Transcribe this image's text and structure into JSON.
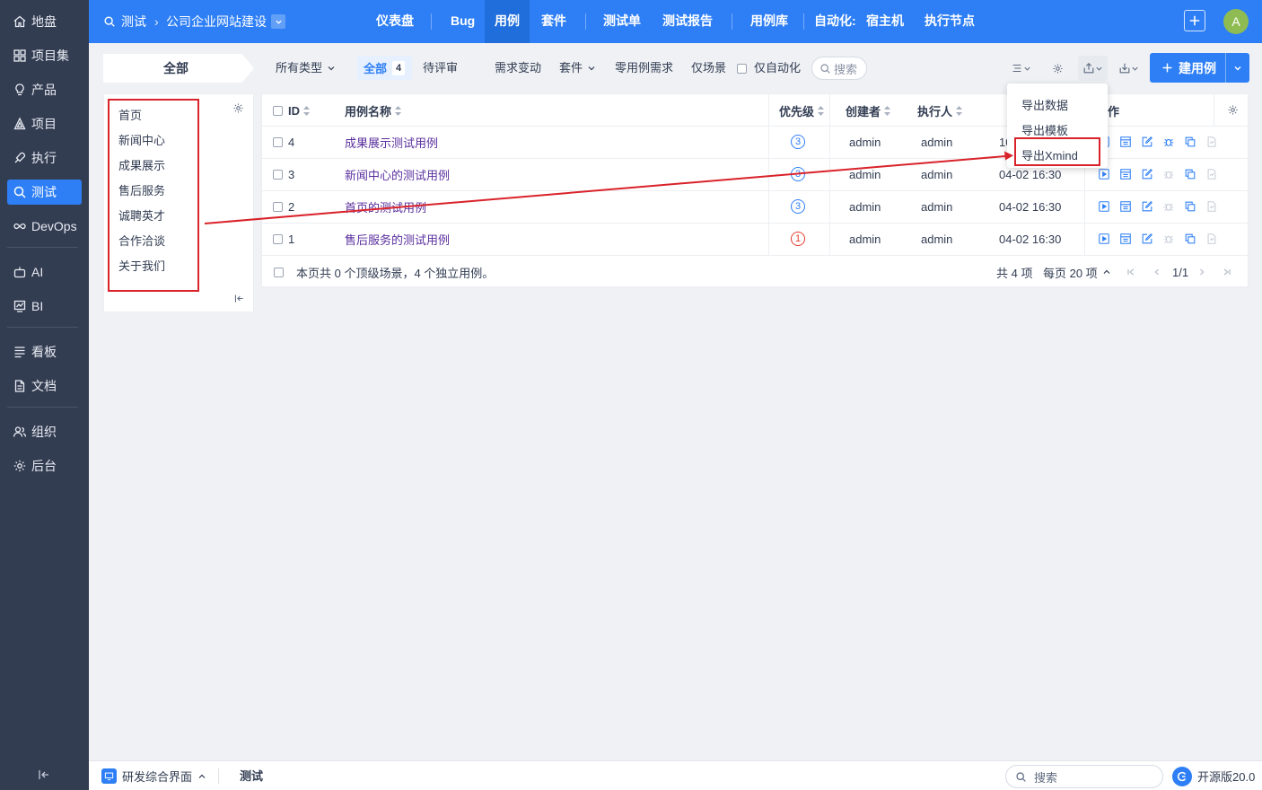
{
  "sidebar": {
    "items": [
      {
        "label": "地盘",
        "icon": "home-icon"
      },
      {
        "label": "项目集",
        "icon": "grid-icon"
      },
      {
        "label": "产品",
        "icon": "bulb-icon"
      },
      {
        "label": "项目",
        "icon": "project-icon"
      },
      {
        "label": "执行",
        "icon": "rocket-icon"
      },
      {
        "label": "测试",
        "icon": "search-icon"
      },
      {
        "label": "DevOps",
        "icon": "infinity-icon"
      },
      {
        "label": "AI",
        "icon": "robot-icon"
      },
      {
        "label": "BI",
        "icon": "chart-icon"
      },
      {
        "label": "看板",
        "icon": "kanban-icon"
      },
      {
        "label": "文档",
        "icon": "doc-icon"
      },
      {
        "label": "组织",
        "icon": "people-icon"
      },
      {
        "label": "后台",
        "icon": "gear-icon"
      }
    ]
  },
  "header": {
    "module": "测试",
    "project": "公司企业网站建设",
    "nav": [
      "仪表盘",
      "Bug",
      "用例",
      "套件",
      "测试单",
      "测试报告",
      "用例库",
      "自动化:",
      "宿主机",
      "执行节点"
    ],
    "active_nav": "用例",
    "avatar": "A"
  },
  "toolbar": {
    "scope": "全部",
    "type_filter": "所有类型",
    "tab_all": "全部",
    "tab_all_count": "4",
    "tab_review": "待评审",
    "tab_change": "需求变动",
    "tab_suite": "套件",
    "tab_zero": "零用例需求",
    "tab_scene": "仅场景",
    "auto_only": "仅自动化",
    "search": "搜索",
    "create_label": "建用例"
  },
  "tree": {
    "items": [
      "首页",
      "新闻中心",
      "成果展示",
      "售后服务",
      "诚聘英才",
      "合作洽谈",
      "关于我们"
    ]
  },
  "table": {
    "columns": {
      "id": "ID",
      "name": "用例名称",
      "priority": "优先级",
      "creator": "创建者",
      "executor": "执行人",
      "actions": "作"
    },
    "rows": [
      {
        "id": "4",
        "name": "成果展示测试用例",
        "priority": "3",
        "creator": "admin",
        "executor": "admin",
        "time": "10"
      },
      {
        "id": "3",
        "name": "新闻中心的测试用例",
        "priority": "3",
        "creator": "admin",
        "executor": "admin",
        "time": "04-02 16:30"
      },
      {
        "id": "2",
        "name": "首页的测试用例",
        "priority": "3",
        "creator": "admin",
        "executor": "admin",
        "time": "04-02 16:30"
      },
      {
        "id": "1",
        "name": "售后服务的测试用例",
        "priority": "1",
        "creator": "admin",
        "executor": "admin",
        "time": "04-02 16:30"
      }
    ],
    "summary": "本页共 0 个顶级场景，4 个独立用例。",
    "total": "共 4 项",
    "per_page": "每页 20 项",
    "page": "1/1"
  },
  "export_menu": {
    "items": [
      "导出数据",
      "导出模板",
      "导出Xmind"
    ]
  },
  "statusbar": {
    "mode": "研发综合界面",
    "crumb": "测试",
    "search": "搜索",
    "version": "开源版20.0"
  },
  "colors": {
    "brand": "#2e7ff5",
    "sidebar": "#333d52",
    "annotation": "#d9222a",
    "link": "#5a2f9e"
  }
}
